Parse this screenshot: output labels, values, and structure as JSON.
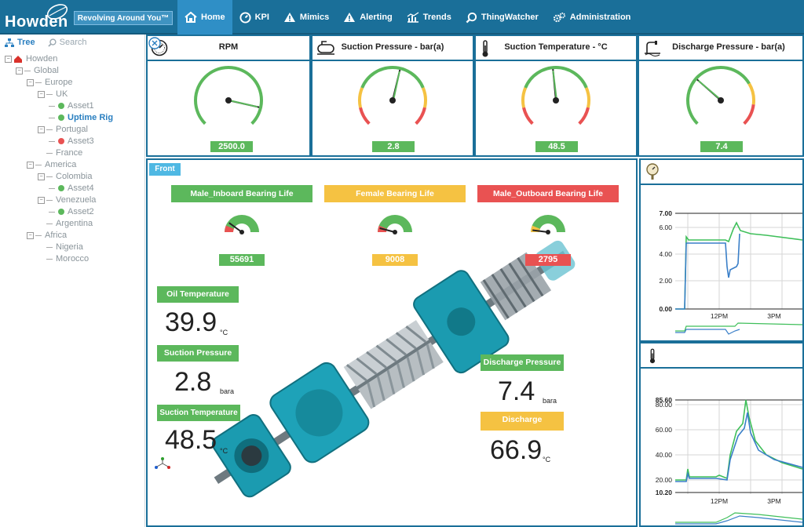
{
  "header": {
    "logo_text": "Howden",
    "tagline": "Revolving Around You™",
    "nav": [
      {
        "label": "Home",
        "icon": "home-icon",
        "active": true
      },
      {
        "label": "KPI",
        "icon": "speedometer-icon"
      },
      {
        "label": "Mimics",
        "icon": "warning-icon"
      },
      {
        "label": "Alerting",
        "icon": "warning-icon"
      },
      {
        "label": "Trends",
        "icon": "chart-icon"
      },
      {
        "label": "ThingWatcher",
        "icon": "search-icon"
      },
      {
        "label": "Administration",
        "icon": "gears-icon"
      }
    ]
  },
  "tree": {
    "tab_tree": "Tree",
    "tab_search": "Search",
    "nodes": [
      {
        "label": "Howden",
        "level": 0,
        "type": "root"
      },
      {
        "label": "Global",
        "level": 1,
        "type": "folder"
      },
      {
        "label": "Europe",
        "level": 2,
        "type": "folder"
      },
      {
        "label": "UK",
        "level": 3,
        "type": "folder"
      },
      {
        "label": "Asset1",
        "level": 4,
        "type": "asset",
        "status": "green"
      },
      {
        "label": "Uptime Rig",
        "level": 4,
        "type": "asset",
        "status": "green",
        "selected": true
      },
      {
        "label": "Portugal",
        "level": 3,
        "type": "folder"
      },
      {
        "label": "Asset3",
        "level": 4,
        "type": "asset",
        "status": "red"
      },
      {
        "label": "France",
        "level": 3,
        "type": "leaf"
      },
      {
        "label": "America",
        "level": 2,
        "type": "folder"
      },
      {
        "label": "Colombia",
        "level": 3,
        "type": "folder"
      },
      {
        "label": "Asset4",
        "level": 4,
        "type": "asset",
        "status": "green"
      },
      {
        "label": "Venezuela",
        "level": 3,
        "type": "folder"
      },
      {
        "label": "Asset2",
        "level": 4,
        "type": "asset",
        "status": "green"
      },
      {
        "label": "Argentina",
        "level": 3,
        "type": "leaf"
      },
      {
        "label": "Africa",
        "level": 2,
        "type": "folder"
      },
      {
        "label": "Nigeria",
        "level": 3,
        "type": "leaf"
      },
      {
        "label": "Morocco",
        "level": 3,
        "type": "leaf"
      }
    ]
  },
  "gauges": [
    {
      "title": "RPM",
      "value": "2500.0",
      "icon": "speedometer-icon",
      "needle_fraction": 0.88,
      "bands": "green"
    },
    {
      "title": "Suction Pressure - bar(a)",
      "value": "2.8",
      "icon": "compressor-icon",
      "needle_fraction": 0.55,
      "bands": "ryg"
    },
    {
      "title": "Suction Temperature - °C",
      "value": "48.5",
      "icon": "thermometer-icon",
      "needle_fraction": 0.48,
      "bands": "ryg"
    },
    {
      "title": "Discharge Pressure - bar(a)",
      "value": "7.4",
      "icon": "pipe-icon",
      "needle_fraction": 0.32,
      "bands": "gyr"
    }
  ],
  "main": {
    "tab": "Front",
    "bearings": [
      {
        "label": "Male_Inboard Bearing Life",
        "value": "55691",
        "color": "#5cb85c"
      },
      {
        "label": "Female Bearing Life",
        "value": "9008",
        "color": "#f5c242"
      },
      {
        "label": "Male_Outboard Bearing Life",
        "value": "2795",
        "color": "#e95252"
      }
    ],
    "oil_temp": {
      "label": "Oil Temperature",
      "value": "39.9",
      "unit": "°C"
    },
    "suction_pressure": {
      "label": "Suction Pressure",
      "value": "2.8",
      "unit": "bara"
    },
    "suction_temp": {
      "label": "Suction Temperature",
      "value": "48.5",
      "unit": "°C"
    },
    "discharge_pressure": {
      "label": "Discharge Pressure",
      "value": "7.4",
      "unit": "bara"
    },
    "discharge_temp": {
      "label": "Discharge",
      "value": "66.9",
      "unit": "°C"
    }
  },
  "colors": {
    "brand": "#1a6f99",
    "nav_active": "#2f8fc6",
    "green": "#5cb85c",
    "yellow": "#f5c242",
    "red": "#e95252",
    "machine": "#1b9bb0"
  },
  "charts": [
    {
      "icon": "pressure-gauge-icon",
      "yticks": [
        "7.00",
        "6.00",
        "4.00",
        "2.00",
        "0.00"
      ],
      "xticks": [
        "12PM",
        "3PM"
      ]
    },
    {
      "icon": "thermometer-icon",
      "yticks": [
        "85.60",
        "80.00",
        "60.00",
        "40.00",
        "20.00",
        "10.20"
      ],
      "xticks": [
        "12PM",
        "3PM"
      ]
    }
  ]
}
